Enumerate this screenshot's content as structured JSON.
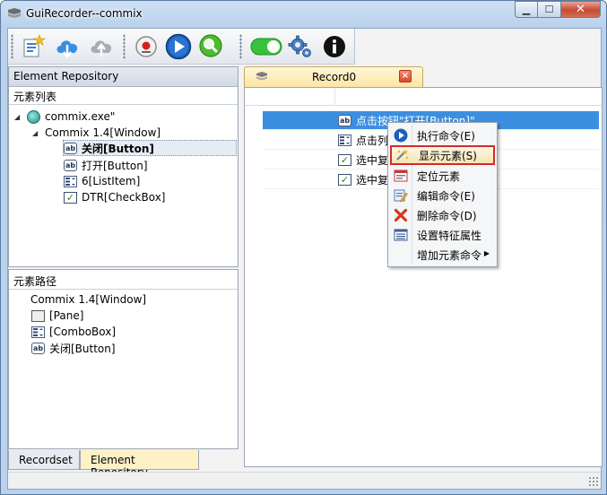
{
  "window": {
    "title": "GuiRecorder--commix",
    "minimize": "▁",
    "maximize": "☐",
    "close": "✕"
  },
  "toolbar": {
    "buttons": [
      {
        "icon": "new-document-icon"
      },
      {
        "icon": "cloud-download-icon"
      },
      {
        "icon": "cloud-upload-icon"
      },
      {
        "icon": "record-icon"
      },
      {
        "icon": "play-icon"
      },
      {
        "icon": "inspect-magnifier-icon"
      },
      {
        "icon": "toggle-on-icon"
      },
      {
        "icon": "settings-gear-icon"
      },
      {
        "icon": "info-icon"
      }
    ]
  },
  "left_panel": {
    "header": "Element Repository",
    "element_list_label": "元素列表",
    "tree": [
      {
        "label": "commix.exe\"",
        "icon": "exe",
        "level": 0
      },
      {
        "label": "Commix 1.4[Window]",
        "icon": "none",
        "level": 1
      },
      {
        "label": "关闭[Button]",
        "icon": "ab",
        "level": 2,
        "selected": true
      },
      {
        "label": "打开[Button]",
        "icon": "ab",
        "level": 2
      },
      {
        "label": "6[ListItem]",
        "icon": "list",
        "level": 2
      },
      {
        "label": "DTR[CheckBox]",
        "icon": "check",
        "level": 2
      }
    ],
    "element_path_label": "元素路径",
    "path": [
      {
        "label": "Commix 1.4[Window]",
        "icon": "none"
      },
      {
        "label": "[Pane]",
        "icon": "pane"
      },
      {
        "label": "[ComboBox]",
        "icon": "list"
      },
      {
        "label": "关闭[Button]",
        "icon": "ab"
      }
    ],
    "tabs": [
      {
        "label": "Recordset",
        "active": false
      },
      {
        "label": "Element Repository",
        "active": true
      }
    ]
  },
  "record_tab": {
    "label": "Record0",
    "close": "×"
  },
  "commands": [
    {
      "text": "点击按钮\"打开[Button]\"",
      "icon": "ab",
      "selected": true
    },
    {
      "text": "点击列表",
      "icon": "list",
      "selected": false
    },
    {
      "text": "选中复",
      "icon": "check",
      "selected": false
    },
    {
      "text": "选中复",
      "icon": "check",
      "selected": false
    }
  ],
  "context_menu": {
    "items": [
      {
        "label": "执行命令(E)",
        "icon": "play-icon"
      },
      {
        "label": "显示元素(S)",
        "icon": "show-element-icon",
        "highlighted": true
      },
      {
        "label": "定位元素",
        "icon": "locate-icon"
      },
      {
        "label": "编辑命令(E)",
        "icon": "edit-icon"
      },
      {
        "label": "删除命令(D)",
        "icon": "delete-icon"
      },
      {
        "label": "设置特征属性",
        "icon": "properties-icon"
      },
      {
        "label": "增加元素命令",
        "icon": "none",
        "submenu": true
      }
    ]
  },
  "colors": {
    "selection_blue": "#3c8fe0",
    "tab_active": "#fef1c6",
    "menu_highlight_border": "#d42a2a"
  }
}
